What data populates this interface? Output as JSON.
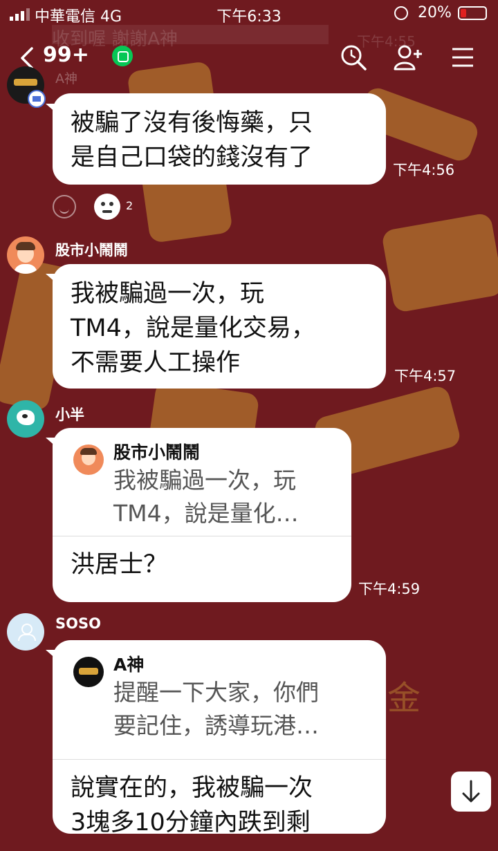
{
  "status_bar": {
    "carrier": "中華電信  4G",
    "time": "下午6:33",
    "battery": "20%"
  },
  "pinned_ghost": {
    "text": "收到喔 謝謝A神",
    "time": "下午4:55"
  },
  "header": {
    "unread": "99+"
  },
  "messages": [
    {
      "sender": "A神",
      "text": "被騙了沒有後悔藥，只\n是自己口袋的錢沒有了",
      "time": "下午4:56",
      "reaction_count": "2"
    },
    {
      "sender": "股市小鬧鬧",
      "text": "我被騙過一次，玩\nTM4，說是量化交易，\n不需要人工操作",
      "time": "下午4:57"
    },
    {
      "sender": "小半",
      "quote_name": "股市小鬧鬧",
      "quote_text": "我被騙過一次，玩\nTM4，說是量化…",
      "text": "洪居士？",
      "time": "下午4:59"
    },
    {
      "sender": "SOSO",
      "quote_name": "A神",
      "quote_text": "提醒一下大家，你們\n要記住，誘導玩港…",
      "text": "說實在的，我被騙一次\n3塊多10分鐘內跌到剩"
    }
  ],
  "background_text": "金",
  "colors": {
    "background": "#6f1a1f",
    "accent": "#06c755",
    "bubble": "#ffffff"
  }
}
